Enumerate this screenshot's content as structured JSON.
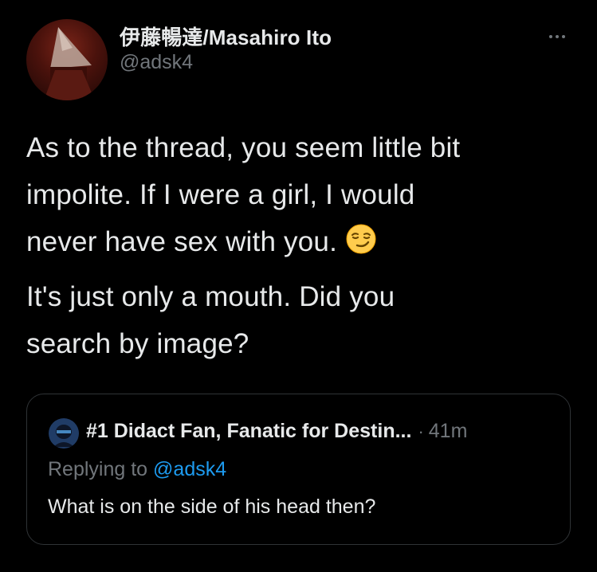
{
  "tweet": {
    "display_name": "伊藤暢達/Masahiro Ito",
    "handle": "@adsk4",
    "more_icon": "more-horizontal-icon",
    "text_lines_p1": [
      "As to the thread, you seem little bit",
      "impolite. If I were a girl, I would",
      "never have sex with you."
    ],
    "emoji": "smirking-face-icon",
    "text_lines_p2": [
      "It's just only a mouth. Did you",
      "search by image?"
    ]
  },
  "quoted": {
    "display_name": "#1 Didact Fan, Fanatic for Destin...",
    "separator": "·",
    "time": "41m",
    "replying_prefix": "Replying to ",
    "replying_handle": "@adsk4",
    "text": "What is on the side of his head then?"
  },
  "colors": {
    "background": "#000000",
    "primary_text": "#e7e9ea",
    "secondary_text": "#71767b",
    "link": "#1d9bf0",
    "border": "#2f3336"
  }
}
